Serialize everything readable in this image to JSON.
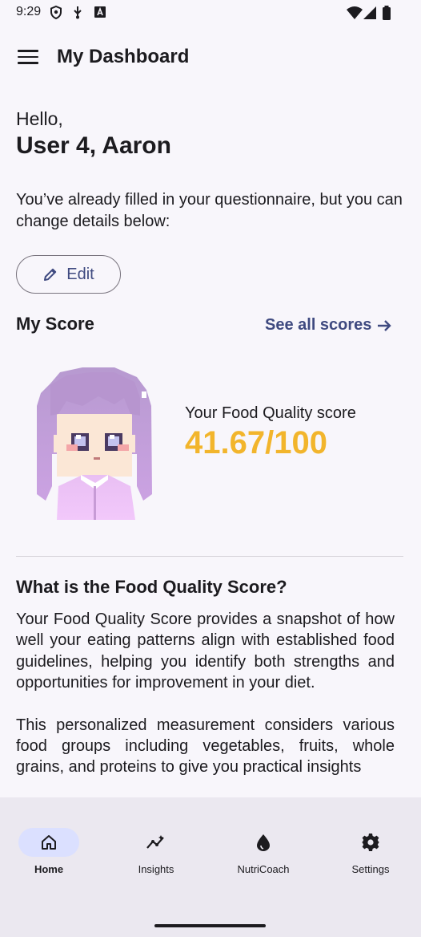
{
  "status_bar": {
    "time": "9:29"
  },
  "app_bar": {
    "title": "My Dashboard"
  },
  "greeting": {
    "hello": "Hello,",
    "name": "User 4, Aaron"
  },
  "intro": "You’ve already filled in your questionnaire, but you can change details below:",
  "edit_button": {
    "label": "Edit"
  },
  "score_section": {
    "title": "My Score",
    "see_all": "See all scores",
    "label": "Your Food Quality score",
    "value": "41.67/100"
  },
  "about": {
    "title": "What is the Food Quality Score?",
    "paragraph1": "Your Food Quality Score provides a snapshot of how well your eating patterns align with established food guidelines, helping you identify both strengths and opportunities for improvement in your diet.",
    "paragraph2": "This personalized measurement considers various food groups including vegetables, fruits, whole grains, and proteins to give you practical insights"
  },
  "bottom_nav": {
    "items": [
      {
        "label": "Home",
        "icon": "home-icon",
        "active": true
      },
      {
        "label": "Insights",
        "icon": "insights-icon",
        "active": false
      },
      {
        "label": "NutriCoach",
        "icon": "drop-icon",
        "active": false
      },
      {
        "label": "Settings",
        "icon": "gear-icon",
        "active": false
      }
    ]
  },
  "colors": {
    "accent": "#3f4a80",
    "score": "#f2b52c",
    "nav_active": "#dbe0ff"
  }
}
